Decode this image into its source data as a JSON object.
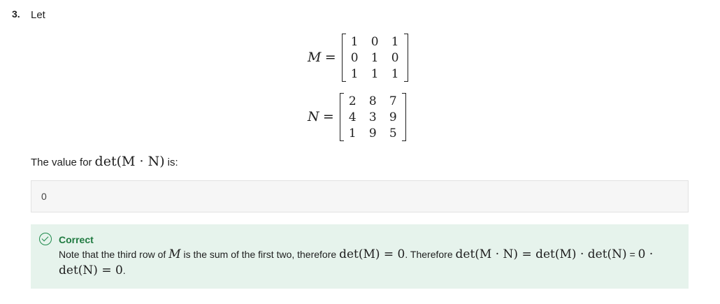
{
  "question": {
    "number": "3.",
    "intro": "Let"
  },
  "matrix_m": {
    "label": "M",
    "equals": "=",
    "rows": [
      [
        "1",
        "0",
        "1"
      ],
      [
        "0",
        "1",
        "0"
      ],
      [
        "1",
        "1",
        "1"
      ]
    ]
  },
  "matrix_n": {
    "label": "N",
    "equals": "=",
    "rows": [
      [
        "2",
        "8",
        "7"
      ],
      [
        "4",
        "3",
        "9"
      ],
      [
        "1",
        "9",
        "5"
      ]
    ]
  },
  "prompt": {
    "before": "The value for",
    "math": "det(M · N)",
    "after": "is:"
  },
  "answer": {
    "value": "0"
  },
  "feedback": {
    "status": "Correct",
    "t1": "Note that the third row of",
    "m1": "M",
    "t2": "is the sum of the first two, therefore",
    "m2": "det(M) = 0",
    "t3": ". Therefore",
    "m3": "det(M · N) = det(M) · det(N)",
    "t4": "=",
    "m4": "0 · det(N) = 0",
    "t5": "."
  },
  "colors": {
    "feedback_bg": "#e6f3ec",
    "correct_green": "#1f7a40",
    "answer_bg": "#f6f6f6"
  }
}
